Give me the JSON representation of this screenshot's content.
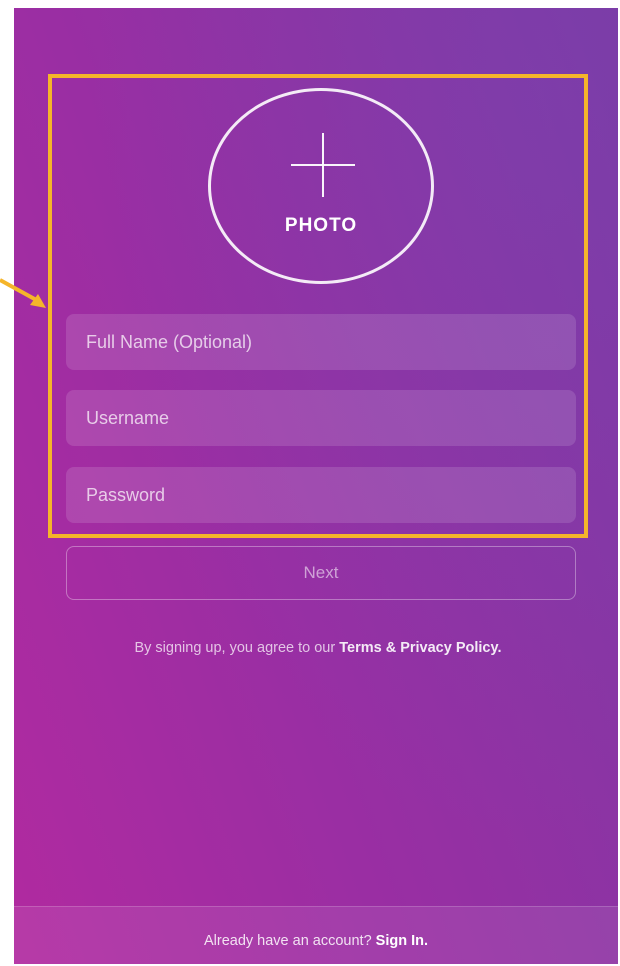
{
  "photo": {
    "icon": "plus-icon",
    "label": "PHOTO"
  },
  "form": {
    "full_name_placeholder": "Full Name (Optional)",
    "username_placeholder": "Username",
    "password_placeholder": "Password",
    "next_label": "Next"
  },
  "terms": {
    "prefix": "By signing up, you agree to our ",
    "link": "Terms & Privacy Policy."
  },
  "footer": {
    "prefix": "Already have an account? ",
    "link": "Sign In."
  },
  "colors": {
    "highlight": "#f5b52a",
    "gradient_start": "#b12aa0",
    "gradient_end": "#7c3aa4"
  }
}
